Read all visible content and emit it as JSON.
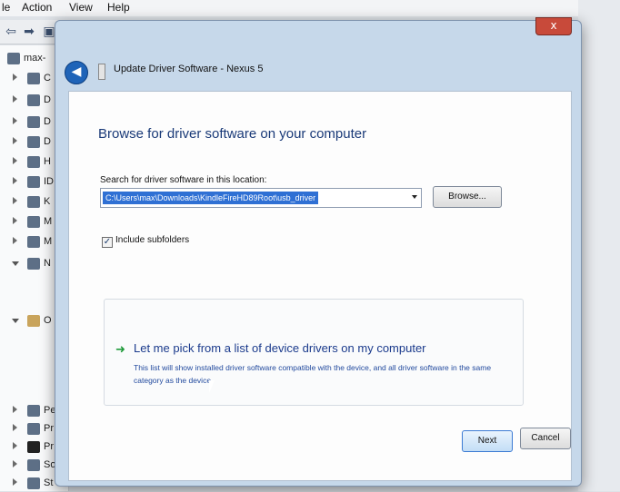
{
  "menubar": {
    "items": [
      "le",
      "Action",
      "View",
      "Help"
    ]
  },
  "tree": {
    "root_label": "max-",
    "items": [
      "C",
      "D",
      "D",
      "D",
      "H",
      "ID",
      "K",
      "M",
      "M",
      "N",
      "O",
      "Pe",
      "Pr",
      "Pr",
      "So",
      "St"
    ]
  },
  "dialog": {
    "title": "Update Driver Software - Nexus 5",
    "close_label": "x",
    "heading": "Browse for driver software on your computer",
    "search_label": "Search for driver software in this location:",
    "path_value": "C:\\Users\\max\\Downloads\\KindleFireHD89Root\\usb_driver",
    "browse_label": "Browse...",
    "include_subfolders_label": "Include subfolders",
    "include_subfolders_checked": "✓",
    "pick_title": "Let me pick from a list of device drivers on my computer",
    "pick_description": "This list will show installed driver software compatible with the device, and all driver software in the same category as the device.",
    "next_label": "Next",
    "cancel_label": "Cancel"
  },
  "colors": {
    "accent": "#2f70d4",
    "heading": "#1a3a78",
    "link": "#1a3a8c",
    "close": "#c84a3a"
  }
}
